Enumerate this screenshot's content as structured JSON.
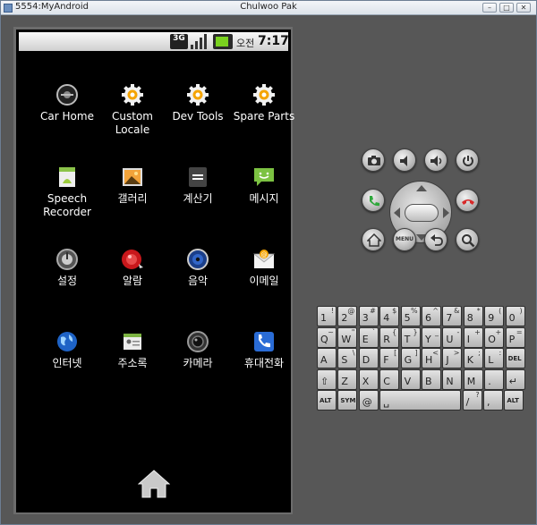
{
  "window": {
    "left_title": "5554:MyAndroid",
    "center_title": "Chulwoo Pak",
    "min_glyph": "–",
    "max_glyph": "□",
    "close_glyph": "✕"
  },
  "statusbar": {
    "network": "3G",
    "ampm": "오전",
    "time": "7:17"
  },
  "apps": [
    {
      "label": "Car Home",
      "icon": "car-home-icon"
    },
    {
      "label": "Custom Locale",
      "icon": "gear-icon"
    },
    {
      "label": "Dev Tools",
      "icon": "gear-icon"
    },
    {
      "label": "Spare Parts",
      "icon": "gear-icon"
    },
    {
      "label": "Speech Recorder",
      "icon": "speech-recorder-icon"
    },
    {
      "label": "갤러리",
      "icon": "gallery-icon"
    },
    {
      "label": "계산기",
      "icon": "calculator-icon"
    },
    {
      "label": "메시지",
      "icon": "message-icon"
    },
    {
      "label": "설정",
      "icon": "settings-icon"
    },
    {
      "label": "알람",
      "icon": "alarm-icon"
    },
    {
      "label": "음악",
      "icon": "music-icon"
    },
    {
      "label": "이메일",
      "icon": "email-icon"
    },
    {
      "label": "인터넷",
      "icon": "globe-icon"
    },
    {
      "label": "주소록",
      "icon": "contacts-icon"
    },
    {
      "label": "카메라",
      "icon": "camera-icon"
    },
    {
      "label": "휴대전화",
      "icon": "phone-icon"
    }
  ],
  "controls": {
    "menu_label": "MENU"
  },
  "keyboard": {
    "rows": [
      [
        {
          "m": "1",
          "a": "!"
        },
        {
          "m": "2",
          "a": "@"
        },
        {
          "m": "3",
          "a": "#"
        },
        {
          "m": "4",
          "a": "$"
        },
        {
          "m": "5",
          "a": "%"
        },
        {
          "m": "6",
          "a": "^"
        },
        {
          "m": "7",
          "a": "&"
        },
        {
          "m": "8",
          "a": "*"
        },
        {
          "m": "9",
          "a": "("
        },
        {
          "m": "0",
          "a": ")"
        }
      ],
      [
        {
          "m": "Q",
          "a": "~"
        },
        {
          "m": "W",
          "a": "\""
        },
        {
          "m": "E",
          "a": "`"
        },
        {
          "m": "R",
          "a": "{"
        },
        {
          "m": "T",
          "a": "}"
        },
        {
          "m": "Y",
          "a": "_"
        },
        {
          "m": "U",
          "a": "-"
        },
        {
          "m": "I",
          "a": "+"
        },
        {
          "m": "O",
          "a": "+"
        },
        {
          "m": "P",
          "a": "="
        }
      ],
      [
        {
          "m": "A",
          "a": ""
        },
        {
          "m": "S",
          "a": "\\"
        },
        {
          "m": "D",
          "a": ""
        },
        {
          "m": "F",
          "a": "["
        },
        {
          "m": "G",
          "a": "]"
        },
        {
          "m": "H",
          "a": "<"
        },
        {
          "m": "J",
          "a": ">"
        },
        {
          "m": "K",
          "a": ";"
        },
        {
          "m": "L",
          "a": ":"
        },
        {
          "m": "DEL",
          "a": ""
        }
      ],
      [
        {
          "m": "⇧",
          "a": ""
        },
        {
          "m": "Z",
          "a": ""
        },
        {
          "m": "X",
          "a": ""
        },
        {
          "m": "C",
          "a": ""
        },
        {
          "m": "V",
          "a": ""
        },
        {
          "m": "B",
          "a": ""
        },
        {
          "m": "N",
          "a": ""
        },
        {
          "m": "M",
          "a": ""
        },
        {
          "m": ".",
          "a": ""
        },
        {
          "m": "↵",
          "a": ""
        }
      ],
      [
        {
          "m": "ALT",
          "a": ""
        },
        {
          "m": "SYM",
          "a": ""
        },
        {
          "m": "@",
          "a": ""
        },
        {
          "m": "␣",
          "a": ""
        },
        {
          "m": "/",
          "a": "?"
        },
        {
          "m": ",",
          "a": ""
        },
        {
          "m": "ALT",
          "a": ""
        }
      ]
    ]
  },
  "colors": {
    "gear_orange": "#f5a400",
    "call_green": "#2fa83c",
    "end_red": "#d72a2a"
  }
}
